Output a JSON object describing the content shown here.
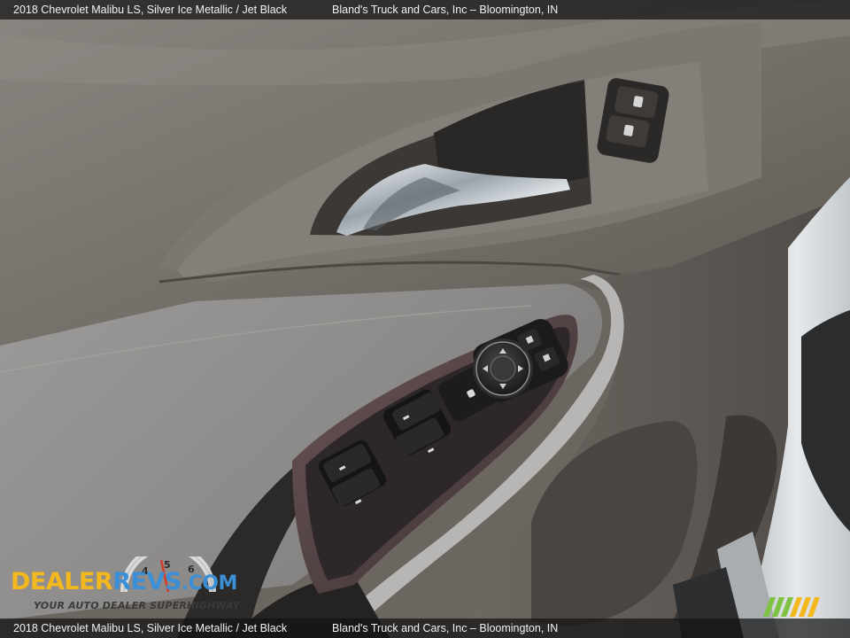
{
  "caption": {
    "vehicle": "2018 Chevrolet Malibu LS,  Silver Ice Metallic / Jet Black",
    "dealer": "Bland's Truck and Cars, Inc – Bloomington, IN"
  },
  "watermark": {
    "brand_part1": "DEALER",
    "brand_part2": "REVS",
    "brand_part3": ".COM",
    "tagline": "YOUR AUTO DEALER SUPERHIGHWAY",
    "gauge_numbers": [
      "4",
      "5",
      "6"
    ]
  },
  "colors": {
    "dealer_yellow": "#f2b81e",
    "revs_blue": "#3a8fd6",
    "stripe_green": "#7dc242",
    "stripe_yellow": "#f2b81e"
  }
}
